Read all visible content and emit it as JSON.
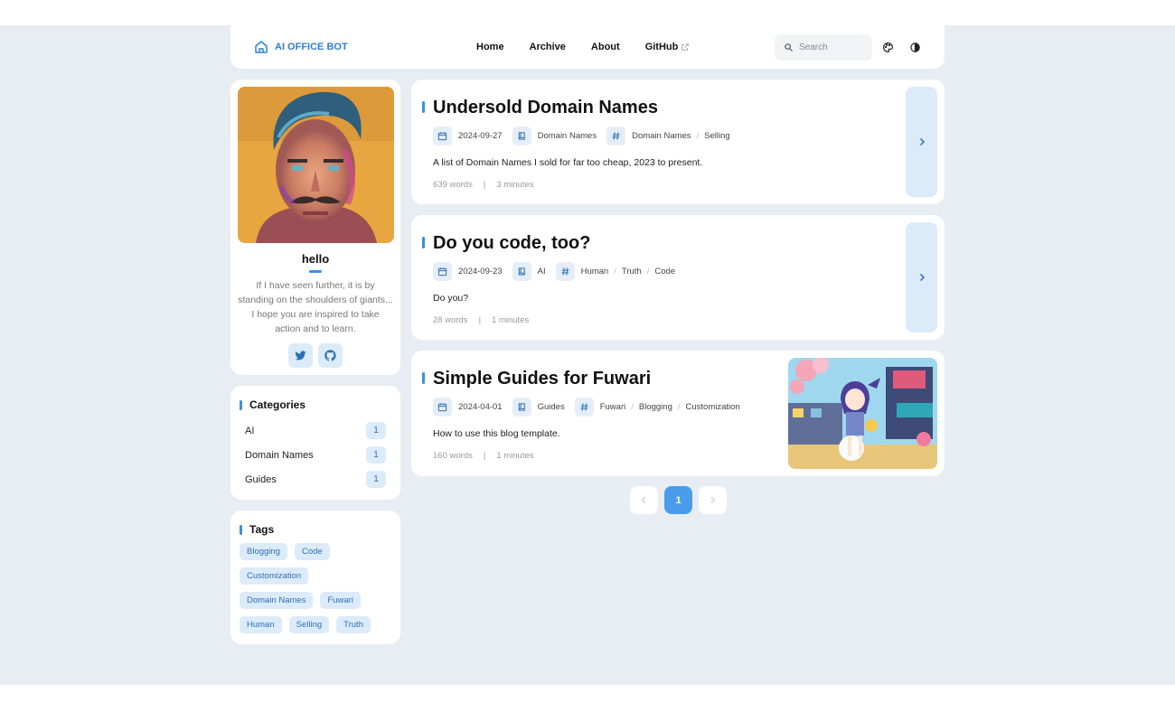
{
  "brand": {
    "name": "AI OFFICE BOT",
    "icon": "home-icon"
  },
  "nav": {
    "links": [
      "Home",
      "Archive",
      "About",
      "GitHub"
    ],
    "search_placeholder": "Search"
  },
  "profile": {
    "name": "hello",
    "bio": "If I have seen further, it is by standing on the shoulders of giants... I hope you are inspired to take action and to learn."
  },
  "categories": {
    "title": "Categories",
    "items": [
      {
        "label": "AI",
        "count": "1"
      },
      {
        "label": "Domain Names",
        "count": "1"
      },
      {
        "label": "Guides",
        "count": "1"
      }
    ]
  },
  "tags": {
    "title": "Tags",
    "items": [
      "Blogging",
      "Code",
      "Customization",
      "Domain Names",
      "Fuwari",
      "Human",
      "Selling",
      "Truth"
    ]
  },
  "posts": [
    {
      "title": "Undersold Domain Names",
      "date": "2024-09-27",
      "category": "Domain Names",
      "tags": [
        "Domain Names",
        "Selling"
      ],
      "description": "A list of Domain Names I sold for far too cheap, 2023 to present.",
      "words": "639 words",
      "time": "3 minutes"
    },
    {
      "title": "Do you code, too?",
      "date": "2024-09-23",
      "category": "AI",
      "tags": [
        "Human",
        "Truth",
        "Code"
      ],
      "description": "Do you?",
      "words": "28 words",
      "time": "1 minutes"
    },
    {
      "title": "Simple Guides for Fuwari",
      "date": "2024-04-01",
      "category": "Guides",
      "tags": [
        "Fuwari",
        "Blogging",
        "Customization"
      ],
      "description": "How to use this blog template.",
      "words": "160 words",
      "time": "1 minutes"
    }
  ],
  "pagination": {
    "current": "1"
  },
  "colors": {
    "accent": "#3d8fe0",
    "accent_soft": "#dcebfa",
    "background": "#e8edf3"
  }
}
